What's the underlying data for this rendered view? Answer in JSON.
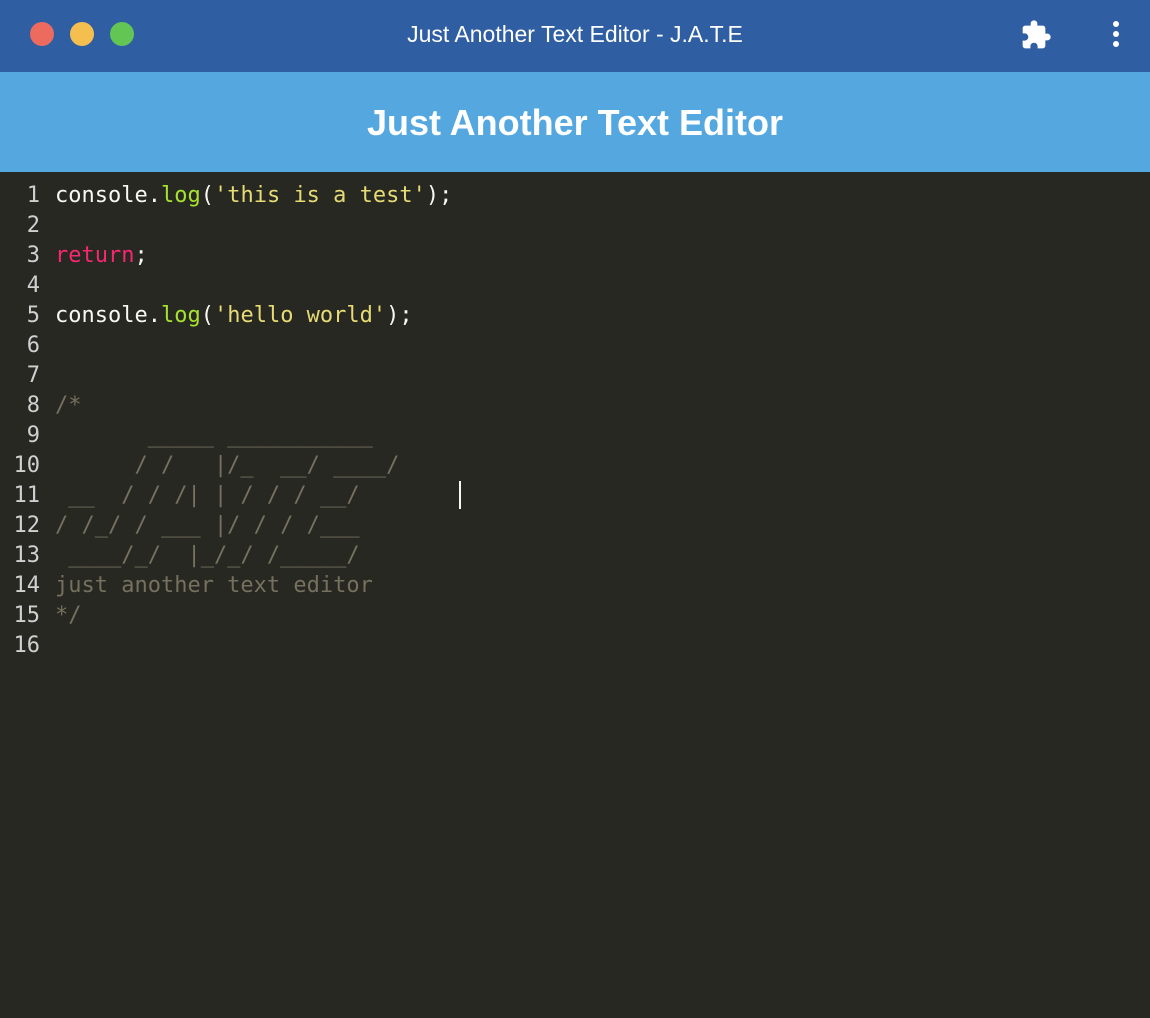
{
  "window": {
    "title": "Just Another Text Editor - J.A.T.E",
    "icons": {
      "close": "close-traffic-light",
      "minimize": "minimize-traffic-light",
      "maximize": "maximize-traffic-light",
      "extensions": "puzzle-piece-icon",
      "menu": "vertical-ellipsis-icon"
    },
    "traffic_colors": [
      "#ed6a5e",
      "#f5bf4f",
      "#62c554"
    ],
    "titlebar_color": "#2f5ea3"
  },
  "header": {
    "title": "Just Another Text Editor",
    "background": "#54a8df"
  },
  "editor": {
    "theme_background": "#272822",
    "lines": [
      {
        "num": "1",
        "tokens": [
          {
            "text": "console.",
            "type": "plain"
          },
          {
            "text": "log",
            "type": "fn"
          },
          {
            "text": "(",
            "type": "plain"
          },
          {
            "text": "'this is a test'",
            "type": "str"
          },
          {
            "text": ");",
            "type": "plain"
          }
        ]
      },
      {
        "num": "2",
        "tokens": []
      },
      {
        "num": "3",
        "tokens": [
          {
            "text": "return",
            "type": "kw"
          },
          {
            "text": ";",
            "type": "plain"
          }
        ]
      },
      {
        "num": "4",
        "tokens": []
      },
      {
        "num": "5",
        "tokens": [
          {
            "text": "console.",
            "type": "plain"
          },
          {
            "text": "log",
            "type": "fn"
          },
          {
            "text": "(",
            "type": "plain"
          },
          {
            "text": "'hello world'",
            "type": "str"
          },
          {
            "text": ");",
            "type": "plain"
          }
        ]
      },
      {
        "num": "6",
        "tokens": []
      },
      {
        "num": "7",
        "tokens": []
      },
      {
        "num": "8",
        "tokens": [
          {
            "text": "/*",
            "type": "comment"
          }
        ]
      },
      {
        "num": "9",
        "tokens": [
          {
            "text": "       _____ ___________",
            "type": "comment"
          }
        ]
      },
      {
        "num": "10",
        "tokens": [
          {
            "text": "      / /   |/_  __/ ____/",
            "type": "comment"
          }
        ]
      },
      {
        "num": "11",
        "tokens": [
          {
            "text": " __  / / /| | / / / __/",
            "type": "comment"
          }
        ]
      },
      {
        "num": "12",
        "tokens": [
          {
            "text": "/ /_/ / ___ |/ / / /___",
            "type": "comment"
          }
        ]
      },
      {
        "num": "13",
        "tokens": [
          {
            "text": " ____/_/  |_/_/ /_____/",
            "type": "comment"
          }
        ]
      },
      {
        "num": "14",
        "tokens": [
          {
            "text": "just another text editor",
            "type": "comment"
          }
        ]
      },
      {
        "num": "15",
        "tokens": [
          {
            "text": "*/",
            "type": "comment"
          }
        ]
      },
      {
        "num": "16",
        "tokens": []
      }
    ]
  }
}
